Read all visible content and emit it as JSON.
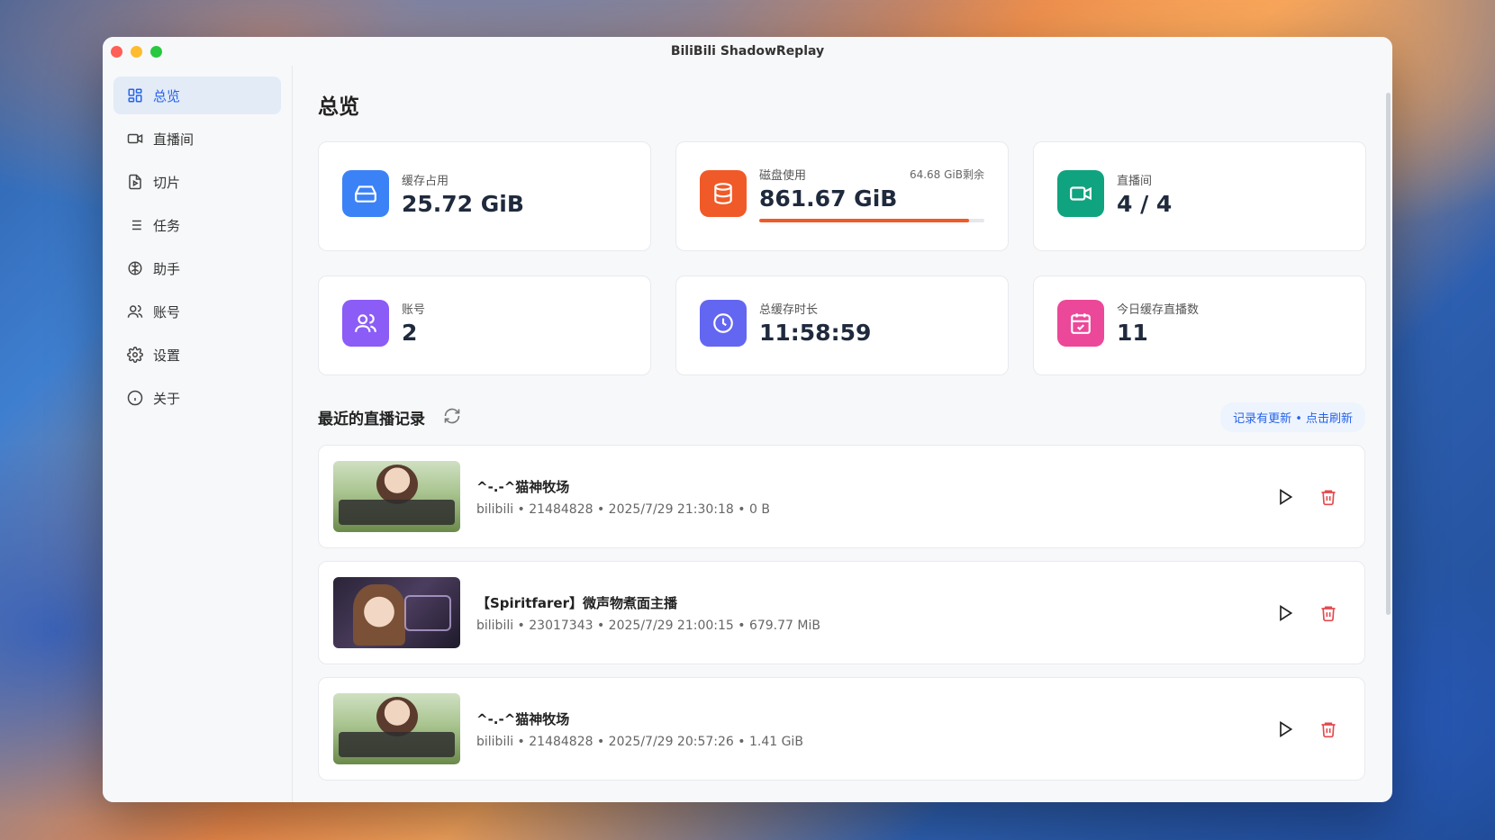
{
  "window": {
    "title": "BiliBili ShadowReplay"
  },
  "sidebar": {
    "items": [
      {
        "label": "总览",
        "icon": "dashboard-icon",
        "active": true
      },
      {
        "label": "直播间",
        "icon": "video-camera-icon",
        "active": false
      },
      {
        "label": "切片",
        "icon": "clip-file-icon",
        "active": false
      },
      {
        "label": "任务",
        "icon": "list-icon",
        "active": false
      },
      {
        "label": "助手",
        "icon": "brain-icon",
        "active": false
      },
      {
        "label": "账号",
        "icon": "users-icon",
        "active": false
      },
      {
        "label": "设置",
        "icon": "gear-icon",
        "active": false
      },
      {
        "label": "关于",
        "icon": "info-icon",
        "active": false
      }
    ]
  },
  "main": {
    "title": "总览",
    "stats": {
      "cache": {
        "label": "缓存占用",
        "value": "25.72 GiB",
        "icon": "hard-drive-icon",
        "color": "#3b82f6"
      },
      "disk": {
        "label": "磁盘使用",
        "value": "861.67 GiB",
        "extra": "64.68 GiB剩余",
        "icon": "database-icon",
        "color": "#f05a28",
        "usage_fraction": 0.93
      },
      "rooms": {
        "label": "直播间",
        "value": "4 / 4",
        "icon": "video-camera-icon",
        "color": "#10a37f"
      },
      "accounts": {
        "label": "账号",
        "value": "2",
        "icon": "users-icon",
        "color": "#8b5cf6"
      },
      "duration": {
        "label": "总缓存时长",
        "value": "11:58:59",
        "icon": "clock-icon",
        "color": "#6366f1"
      },
      "today": {
        "label": "今日缓存直播数",
        "value": "11",
        "icon": "calendar-check-icon",
        "color": "#ec4899"
      }
    },
    "recent": {
      "title": "最近的直播记录",
      "update_notice": "记录有更新 • 点击刷新",
      "records": [
        {
          "title": "^-.-^猫神牧场",
          "meta": "bilibili • 21484828 • 2025/7/29 21:30:18 • 0 B"
        },
        {
          "title": "【Spiritfarer】微声物煮面主播",
          "meta": "bilibili • 23017343 • 2025/7/29 21:00:15 • 679.77 MiB"
        },
        {
          "title": "^-.-^猫神牧场",
          "meta": "bilibili • 21484828 • 2025/7/29 20:57:26 • 1.41 GiB"
        }
      ]
    }
  }
}
